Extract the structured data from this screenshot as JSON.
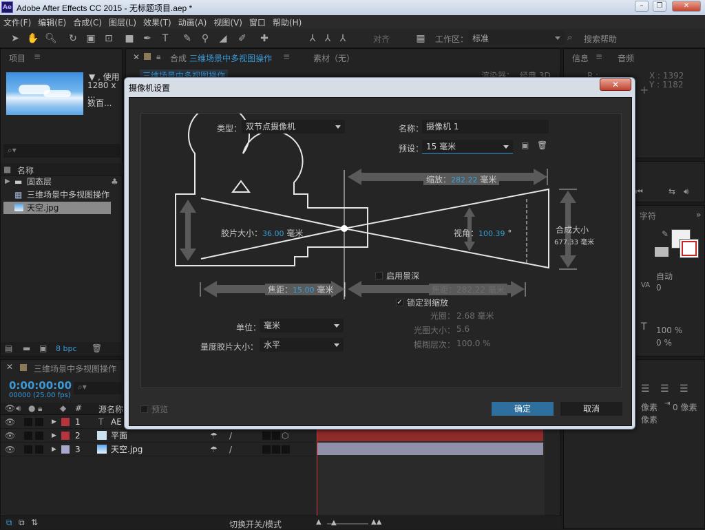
{
  "app": {
    "logo": "Ae",
    "title": "Adobe After Effects CC 2015 - 无标题项目.aep *"
  },
  "menu": [
    "文件(F)",
    "编辑(E)",
    "合成(C)",
    "图层(L)",
    "效果(T)",
    "动画(A)",
    "视图(V)",
    "窗口",
    "帮助(H)"
  ],
  "toolbar": {
    "snap_label": "对齐",
    "workspace_label": "工作区：",
    "workspace_value": "标准",
    "search_placeholder": "搜索帮助"
  },
  "project_panel": {
    "tab": "项目",
    "preview_info": "▼ , 使用",
    "preview_size": "1280 x ...",
    "preview_count": "数百...",
    "column_name": "名称",
    "items": [
      "固态层",
      "三维场景中多视图操作",
      "天空.jpg"
    ],
    "bpc": "8 bpc"
  },
  "comp_panel": {
    "tab_comp": "合成",
    "tab_comp_name": "三维场景中多视图操作",
    "tab_footage": "素材（无）",
    "breadcrumb": "三维场景中多视图操作",
    "renderer": "渲染器：",
    "renderer_value": "经典 3D"
  },
  "info_panel": {
    "tab_info": "信息",
    "tab_audio": "音频",
    "r": "R :",
    "x": "X : 1392",
    "y": "Y : 1182"
  },
  "character_panel": {
    "tab": "字符",
    "auto": "自动",
    "kerning": "0",
    "scale_v": "100 %",
    "baseline": "0 %",
    "px1": "像素",
    "px2": "0 像素",
    "px3": "像素"
  },
  "timeline": {
    "tab": "三维场景中多视图操作",
    "timecode": "0:00:00:00",
    "frames": "00000 (25.00 fps)",
    "col_hash": "#",
    "col_source": "源名称",
    "layers": [
      {
        "num": "1",
        "name": "AE",
        "color": "#b8343c"
      },
      {
        "num": "2",
        "name": "平面",
        "color": "#b8343c"
      },
      {
        "num": "3",
        "name": "天空.jpg",
        "color": "#a7a7cf"
      }
    ],
    "toggle_label": "切换开关/模式"
  },
  "dialog": {
    "title": "摄像机设置",
    "type_label": "类型：",
    "type_value": "双节点摄像机",
    "name_label": "名称：",
    "name_value": "摄像机 1",
    "preset_label": "预设：",
    "preset_value": "15 毫米",
    "zoom_label": "缩放：",
    "zoom_value": "282.22",
    "zoom_unit": "毫米",
    "film_label": "胶片大小：",
    "film_value": "36.00",
    "film_unit": "毫米",
    "angle_label": "视角：",
    "angle_value": "100.39",
    "angle_unit": "°",
    "comp_size_label": "合成大小",
    "comp_size_value": "677.33 毫米",
    "focal_label": "焦距：",
    "focal_value": "15.00",
    "focal_unit": "毫米",
    "focus_dist_label": "焦距：",
    "focus_dist_value": "282.22 毫米",
    "dof_label": "启用景深",
    "lock_label": "锁定到缩放",
    "aperture_label": "光圈：",
    "aperture_value": "2.68 毫米",
    "fstop_label": "光圈大小：",
    "fstop_value": "5.6",
    "blur_label": "模糊层次：",
    "blur_value": "100.0 %",
    "units_label": "单位：",
    "units_value": "毫米",
    "measure_label": "量度胶片大小：",
    "measure_value": "水平",
    "preview_label": "预览",
    "ok_label": "确定",
    "cancel_label": "取消",
    "ok_color": "#2e6f9e"
  }
}
